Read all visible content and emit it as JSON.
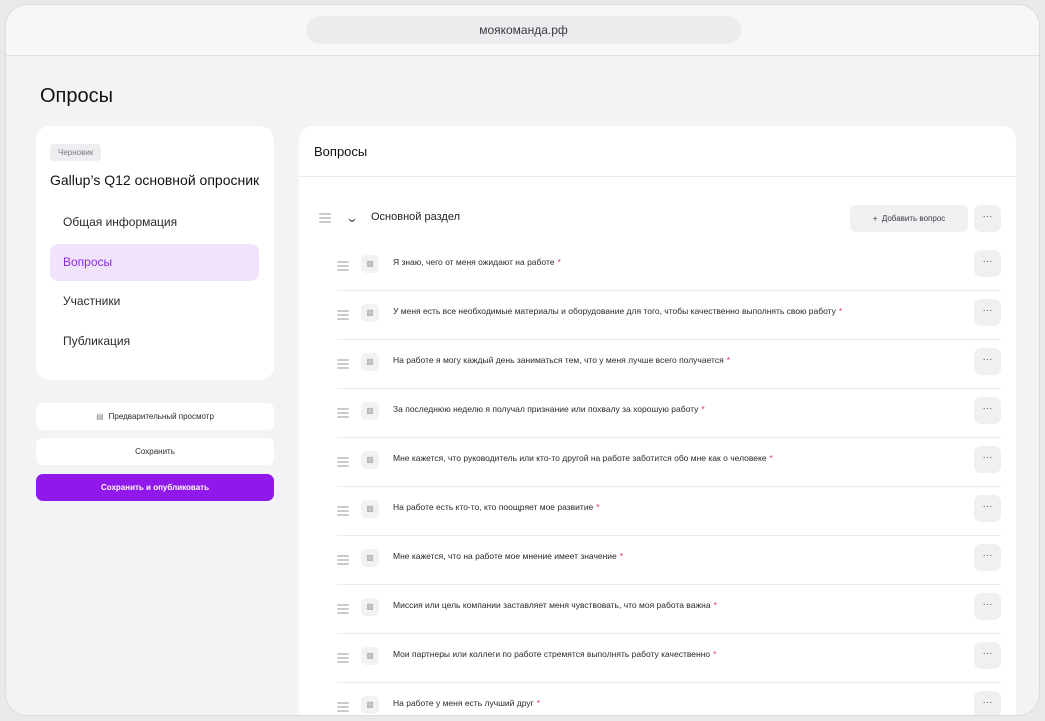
{
  "browser": {
    "url": "моякоманда.рф"
  },
  "page": {
    "title": "Опросы"
  },
  "sidebar": {
    "status_badge": "Черновик",
    "survey_name": "Gallup’s Q12 основной опросник",
    "items": [
      {
        "label": "Общая информация",
        "active": false
      },
      {
        "label": "Вопросы",
        "active": true
      },
      {
        "label": "Участники",
        "active": false
      },
      {
        "label": "Публикация",
        "active": false
      }
    ]
  },
  "actions": {
    "preview_label": "Предварительный просмотр",
    "save_label": "Сохранить",
    "save_publish_label": "Сохранить и опубликовать",
    "accent_color": "#9118ea"
  },
  "main": {
    "title": "Вопросы",
    "section": {
      "label": "Основной раздел",
      "add_question_label": "Добавить вопрос",
      "more_label": "···"
    },
    "questions": [
      {
        "text": "Я знаю, чего от меня ожидают на работе",
        "required": "*"
      },
      {
        "text": "У меня есть все необходимые материалы и оборудование для того, чтобы качественно выполнять свою работу",
        "required": "*"
      },
      {
        "text": "На работе я могу каждый день заниматься тем, что у меня лучше всего получается",
        "required": "*"
      },
      {
        "text": "За последнюю неделю я получал признание или похвалу за хорошую работу",
        "required": "*"
      },
      {
        "text": "Мне кажется, что руководитель или кто-то другой на работе заботится обо мне как о человеке",
        "required": "*"
      },
      {
        "text": "На работе есть кто-то, кто поощряет мое развитие",
        "required": "*"
      },
      {
        "text": "Мне кажется, что на работе мое мнение имеет значение",
        "required": "*"
      },
      {
        "text": "Миссия или цель компании заставляет меня чувствовать, что моя работа важна",
        "required": "*"
      },
      {
        "text": "Мои партнеры или коллеги по работе стремятся выполнять работу качественно",
        "required": "*"
      },
      {
        "text": "На работе у меня есть лучший друг",
        "required": "*"
      }
    ]
  }
}
